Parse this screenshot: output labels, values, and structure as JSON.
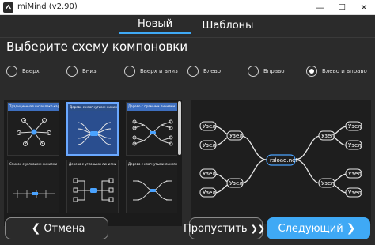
{
  "window": {
    "title": "miMind (v2.90)"
  },
  "tabs": {
    "new_label": "Новый",
    "templates_label": "Шаблоны"
  },
  "heading": "Выберите схему компоновки",
  "layout_options": [
    {
      "label": "Вверх",
      "checked": false
    },
    {
      "label": "Вниз",
      "checked": false
    },
    {
      "label": "Вверх и вниз",
      "checked": false
    },
    {
      "label": "Влево",
      "checked": false
    },
    {
      "label": "Вправо",
      "checked": false
    },
    {
      "label": "Влево и вправо",
      "checked": true
    }
  ],
  "thumbnails": [
    {
      "caption": "Традиционная интеллект-карта"
    },
    {
      "caption": "Дерево с изогнутыми линиями"
    },
    {
      "caption": "Дерево с прямыми линиями"
    },
    {
      "caption": "Список с угловыми линиями"
    },
    {
      "caption": "Дерево с угловыми линиями"
    },
    {
      "caption": "Дерево с изогнутыми линиями"
    }
  ],
  "preview": {
    "root_label": "rsload.net",
    "node_label": "Узел"
  },
  "buttons": {
    "cancel_label": "Отмена",
    "skip_label": "Пропустить",
    "next_label": "Следующий"
  },
  "colors": {
    "accent": "#3fa9f5",
    "background": "#2b2b2b",
    "selected_border": "#6aa8ff"
  }
}
